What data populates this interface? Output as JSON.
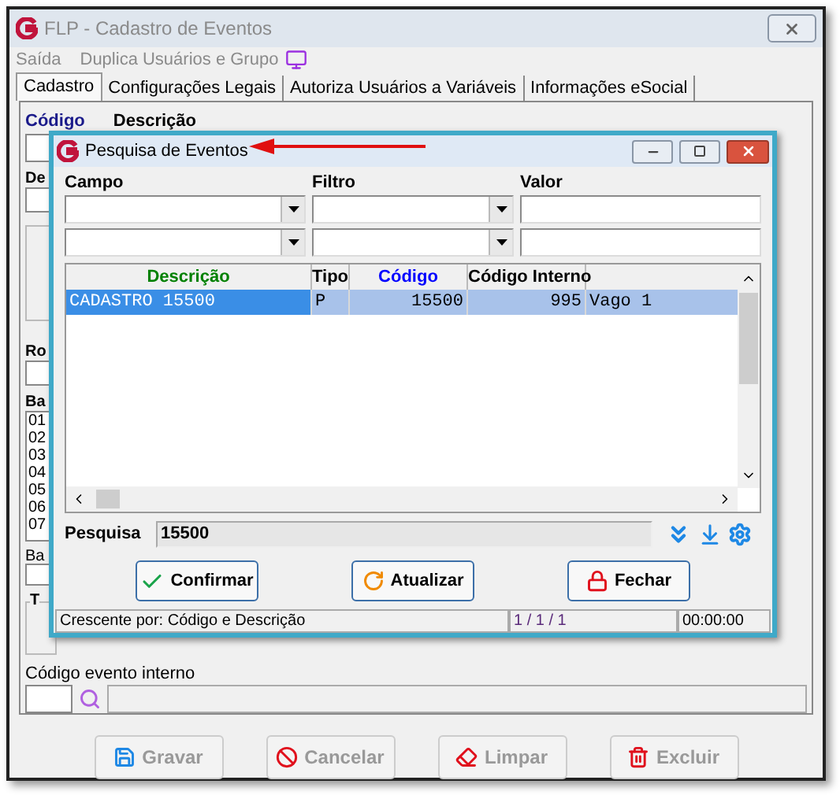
{
  "window": {
    "title": "FLP - Cadastro de Eventos"
  },
  "menu": [
    {
      "label": "Saída"
    },
    {
      "label": "Duplica Usuários e Grupo"
    }
  ],
  "tabs": [
    {
      "label": "Cadastro",
      "selected": true
    },
    {
      "label": "Configurações Legais",
      "selected": false
    },
    {
      "label": "Autoriza Usuários a Variáveis",
      "selected": false
    },
    {
      "label": "Informações eSocial",
      "selected": false
    }
  ],
  "form": {
    "codigo_label": "Código",
    "descricao_label": "Descrição",
    "label_2": "De",
    "label_3": "Ro",
    "label_4": "Ba",
    "list_items": [
      "01",
      "02",
      "03",
      "04",
      "05",
      "06",
      "07"
    ],
    "label_5": "Ba",
    "group_label": "T",
    "codigo_evento_interno_label": "Código evento interno"
  },
  "dialog": {
    "title": "Pesquisa de Eventos",
    "filter_headers": [
      "Campo",
      "Filtro",
      "Valor"
    ],
    "table": {
      "columns": [
        {
          "label": "Descrição",
          "color": "#008000"
        },
        {
          "label": "Tipo",
          "color": "#000000"
        },
        {
          "label": "Código",
          "color": "#0000ff"
        },
        {
          "label": "Código Interno",
          "color": "#000000"
        }
      ],
      "rows": [
        {
          "cells": [
            "CADASTRO 15500",
            "P",
            "15500",
            "995",
            "Vago 1"
          ],
          "selected": true
        }
      ]
    },
    "search": {
      "label": "Pesquisa",
      "value": "15500"
    },
    "buttons": [
      {
        "label": "Confirmar",
        "kind": "confirm"
      },
      {
        "label": "Atualizar",
        "kind": "refresh"
      },
      {
        "label": "Fechar",
        "kind": "close"
      }
    ],
    "status_bar": [
      "Crescente por: Código e Descrição",
      "1 / 1 / 1",
      "00:00:00"
    ]
  },
  "actions": [
    {
      "label": "Gravar",
      "kind": "save"
    },
    {
      "label": "Cancelar",
      "kind": "cancel"
    },
    {
      "label": "Limpar",
      "kind": "clear"
    },
    {
      "label": "Excluir",
      "kind": "delete"
    }
  ]
}
